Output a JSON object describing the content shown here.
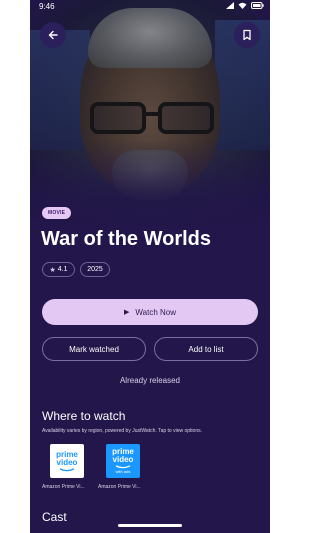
{
  "status_bar": {
    "time": "9:46"
  },
  "header": {
    "back_icon": "arrow-left-icon",
    "bookmark_icon": "bookmark-icon"
  },
  "movie": {
    "badge": "MOVIE",
    "title": "War of the Worlds",
    "rating": "4.1",
    "year": "2025"
  },
  "actions": {
    "watch_now": "Watch Now",
    "mark_watched": "Mark watched",
    "add_to_list": "Add to list",
    "release_status": "Already released"
  },
  "where_to_watch": {
    "title": "Where to watch",
    "subtitle": "Availability varies by region, powered by JustWatch. Tap to view options.",
    "providers": [
      {
        "label": "Amazon Prime Vi...",
        "logo_line1": "prime",
        "logo_line2": "video",
        "logo_line3": ""
      },
      {
        "label": "Amazon Prime Vi...",
        "logo_line1": "prime",
        "logo_line2": "video",
        "logo_line3": "with ads"
      }
    ]
  },
  "cast": {
    "title": "Cast"
  },
  "colors": {
    "background": "#22164a",
    "accent": "#e4c8f4",
    "prime_blue": "#1a98ff"
  }
}
